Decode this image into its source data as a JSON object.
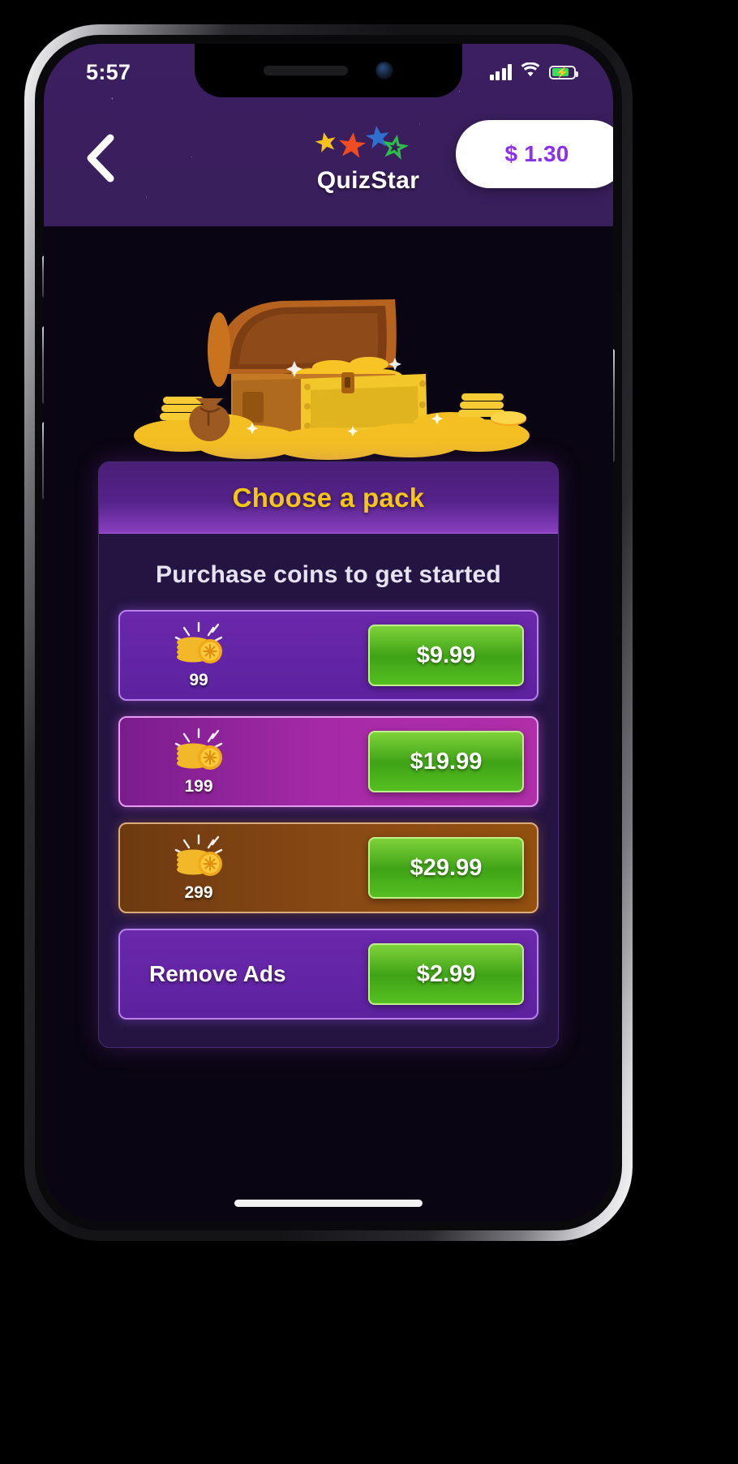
{
  "status_bar": {
    "time": "5:57",
    "signal_icon": "cellular-signal-icon",
    "wifi_icon": "wifi-icon",
    "battery_icon": "battery-charging-icon"
  },
  "header": {
    "back_icon": "chevron-left-icon",
    "brand_name": "QuizStar",
    "brand_logo_icon": "stars-logo-icon",
    "balance": "$ 1.30"
  },
  "hero": {
    "image_icon": "treasure-chest-icon"
  },
  "panel": {
    "title": "Choose a pack",
    "subtitle": "Purchase coins to get started",
    "packs": [
      {
        "coin_count": "99",
        "label": "",
        "price": "$9.99",
        "theme": "theme-purple",
        "coin_icon": "coin-stack-icon"
      },
      {
        "coin_count": "199",
        "label": "",
        "price": "$19.99",
        "theme": "theme-magenta",
        "coin_icon": "coin-stack-icon"
      },
      {
        "coin_count": "299",
        "label": "",
        "price": "$29.99",
        "theme": "theme-brown",
        "coin_icon": "coin-stack-icon"
      },
      {
        "coin_count": "",
        "label": "Remove Ads",
        "price": "$2.99",
        "theme": "theme-purple",
        "coin_icon": ""
      }
    ]
  },
  "colors": {
    "header_purple": "#3a1e5e",
    "panel_bg": "#241442",
    "title_gold": "#f5c518",
    "price_green": "#4caf18",
    "balance_purple": "#8b2ff0",
    "body_black": "#0a0512"
  }
}
